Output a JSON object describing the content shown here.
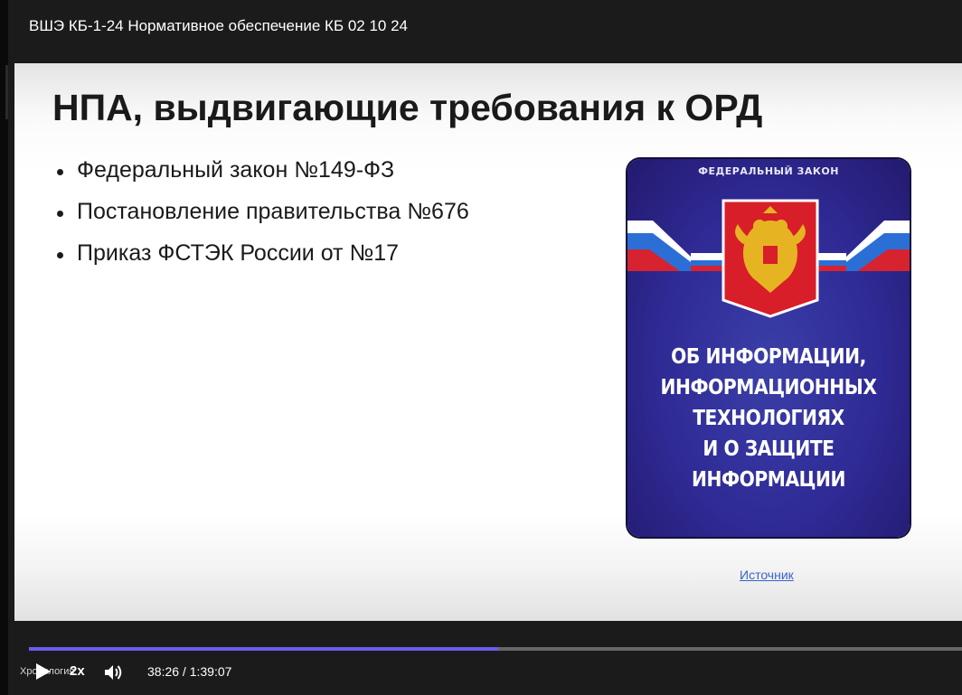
{
  "video": {
    "title": "ВШЭ КБ-1-24 Нормативное обеспечение КБ 02 10 24"
  },
  "slide": {
    "heading": "НПА, выдвигающие требования к ОРД",
    "bullets": [
      "Федеральный закон №149-ФЗ",
      "Постановление правительства №676",
      "Приказ ФСТЭК России от №17"
    ],
    "book_cover": {
      "header": "ФЕДЕРАЛЬНЫЙ ЗАКОН",
      "title_lines": [
        "ОБ ИНФОРМАЦИИ,",
        "ИНФОРМАЦИОННЫХ",
        "ТЕХНОЛОГИЯХ",
        "И О ЗАЩИТЕ",
        "ИНФОРМАЦИИ"
      ]
    },
    "source_link": "Источник"
  },
  "player": {
    "progress_fraction": 0.5025,
    "chapter_label": "Хронология",
    "speed": "2x",
    "time": "38:26 / 1:39:07",
    "accent_color": "#6a5cf0"
  }
}
